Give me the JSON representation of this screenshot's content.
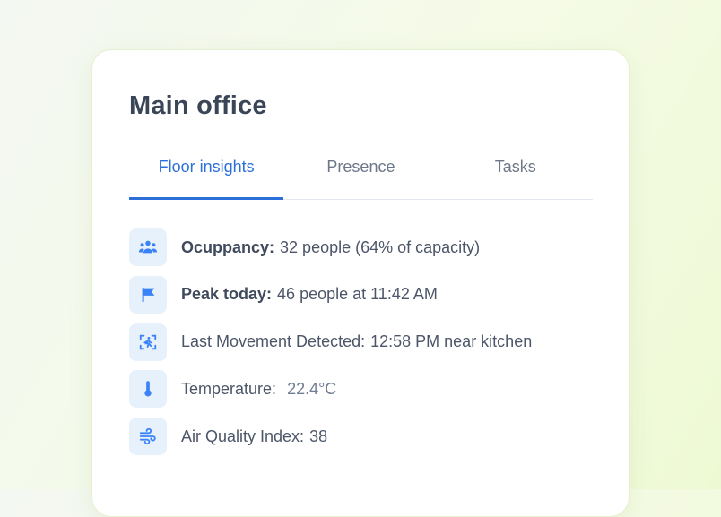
{
  "panel": {
    "title": "Main office",
    "tabs": [
      {
        "label": "Floor insights",
        "active": true
      },
      {
        "label": "Presence",
        "active": false
      },
      {
        "label": "Tasks",
        "active": false
      }
    ],
    "rows": [
      {
        "icon": "people-group-icon",
        "label": "Ocuppancy:",
        "value": "32 people (64% of capacity)"
      },
      {
        "icon": "flag-icon",
        "label": "Peak today:",
        "value": "46 people at 11:42 AM"
      },
      {
        "icon": "motion-sensor-icon",
        "label": "Last Movement Detected:",
        "value": "12:58 PM near kitchen"
      },
      {
        "icon": "thermometer-icon",
        "label": "Temperature:",
        "value": "22.4°C"
      },
      {
        "icon": "wind-icon",
        "label": "Air Quality Index:",
        "value": "38"
      }
    ]
  },
  "colors": {
    "accent": "#2d6fd8",
    "icon": "#3b82f6",
    "icon_bg": "#e7f1fc",
    "text": "#4c5668",
    "title": "#3a4658"
  }
}
